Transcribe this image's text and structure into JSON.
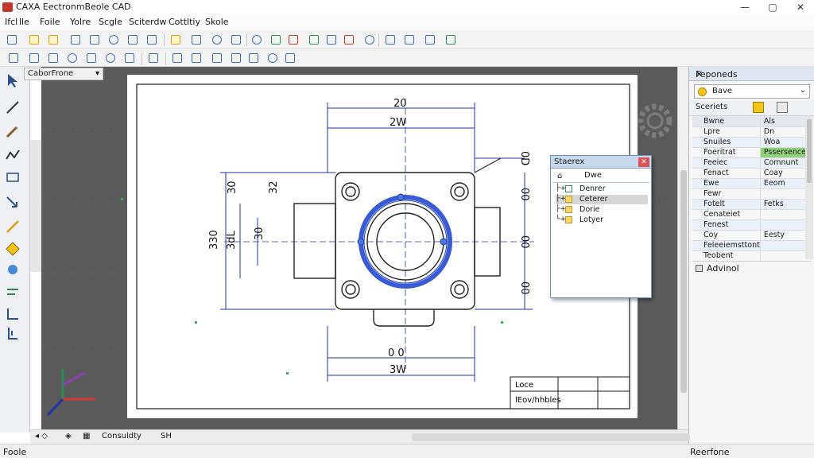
{
  "window": {
    "title": "CAXA EectronmBeole CAD",
    "controls": [
      "—",
      "▢",
      "✕"
    ]
  },
  "menu": [
    "Ifcl",
    "lle",
    "Foile",
    "Yolre",
    "Scgle",
    "Sciterdw",
    "Cottltiy",
    "Skole"
  ],
  "model_tab": {
    "label": "CaborFrone",
    "arrow": "▾"
  },
  "drawing": {
    "dims": {
      "top_outer": "20",
      "top_inner": "2W",
      "left_outer": "30",
      "left_total": "330",
      "left_mid": "3dL",
      "left_inner": "30",
      "left_inner2": "32",
      "right_top": "0D",
      "right_mid": "00",
      "right_center": "00",
      "right_bottom": "00",
      "bottom_outer": "0 0",
      "bottom_inner": "3W"
    },
    "title_block": {
      "row1": "Loce",
      "row2": "lEov/hhbles"
    }
  },
  "float_panel": {
    "title": "Staerex",
    "close": "✕",
    "toolbar_label": "Dwe",
    "items": [
      {
        "label": "Denrer",
        "selected": false
      },
      {
        "label": "Ceterer",
        "selected": true
      },
      {
        "label": "Dorie",
        "selected": false
      },
      {
        "label": "Lotyer",
        "selected": false
      }
    ]
  },
  "right_panel": {
    "title": "Feponeds",
    "close": "✕",
    "selector": {
      "value": "Bave",
      "arrow": "⌄"
    },
    "toolbar_label": "Sceriets",
    "table_header": [
      "Bwne",
      "Als"
    ],
    "rows": [
      [
        "Lpre",
        "Dn"
      ],
      [
        "Snuiles",
        "Woa"
      ],
      [
        "Foeritrat",
        "Pssersence"
      ],
      [
        "Feeiec",
        "Comnunt"
      ],
      [
        "Fenact",
        "Coay"
      ],
      [
        "Ewe",
        "Eeom"
      ],
      [
        "Fewr",
        ""
      ],
      [
        "Fotelt",
        "Fetks"
      ],
      [
        "Cenateiet",
        ""
      ],
      [
        "Fenest",
        ""
      ],
      [
        "Coy",
        "Eesty"
      ],
      [
        "Feleeiemsttont",
        ""
      ],
      [
        "Teobent",
        ""
      ]
    ],
    "advanced_label": "Advinol"
  },
  "bottom_tabs": [
    "Consuldty",
    "SH"
  ],
  "status": {
    "left": "Foole",
    "right": "Reerfone"
  },
  "colors": {
    "canvas": "#5b5b5b",
    "sheet": "#ffffff",
    "dimension": "#2233aa",
    "highlight_ring": "#3a5bd6",
    "accent_panel": "#dfe6ef"
  }
}
